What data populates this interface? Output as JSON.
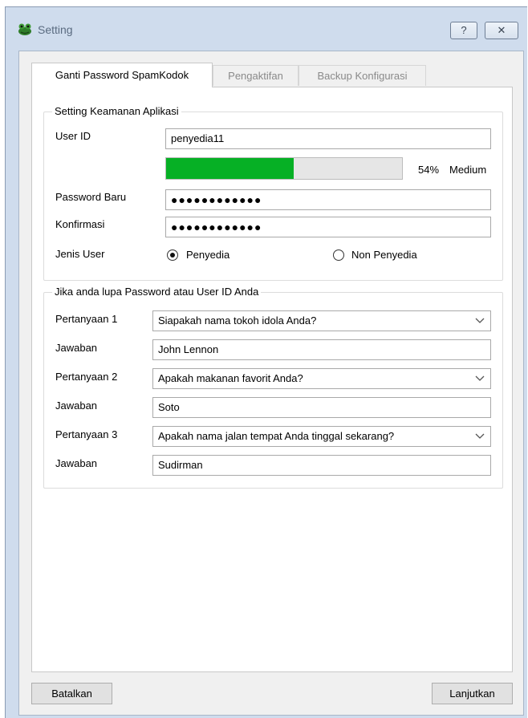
{
  "window": {
    "title": "Setting",
    "help_glyph": "?",
    "close_glyph": "✕"
  },
  "tabs": [
    {
      "label": "Ganti Password SpamKodok",
      "active": true
    },
    {
      "label": "Pengaktifan",
      "active": false
    },
    {
      "label": "Backup Konfigurasi",
      "active": false
    }
  ],
  "security": {
    "title": "Setting Keamanan Aplikasi",
    "user_id_label": "User ID",
    "user_id_value": "penyedia11",
    "strength_percent_text": "54%",
    "strength_fraction": 0.54,
    "strength_label": "Medium",
    "password_label": "Password Baru",
    "password_mask": "●●●●●●●●●●●●",
    "confirm_label": "Konfirmasi",
    "confirm_mask": "●●●●●●●●●●●●",
    "user_type_label": "Jenis User",
    "options": [
      {
        "label": "Penyedia",
        "checked": true
      },
      {
        "label": "Non Penyedia",
        "checked": false
      }
    ]
  },
  "recovery": {
    "title": "Jika anda lupa Password atau User ID Anda",
    "items": [
      {
        "question_label": "Pertanyaan 1",
        "question": "Siapakah nama tokoh idola Anda?",
        "answer_label": "Jawaban",
        "answer": "John Lennon"
      },
      {
        "question_label": "Pertanyaan 2",
        "question": "Apakah makanan favorit Anda?",
        "answer_label": "Jawaban",
        "answer": "Soto"
      },
      {
        "question_label": "Pertanyaan 3",
        "question": "Apakah nama jalan tempat Anda tinggal sekarang?",
        "answer_label": "Jawaban",
        "answer": "Sudirman"
      }
    ]
  },
  "footer": {
    "cancel_label": "Batalkan",
    "next_label": "Lanjutkan"
  },
  "colors": {
    "progress_fill": "#06b025",
    "window_frame": "#cfdced"
  }
}
